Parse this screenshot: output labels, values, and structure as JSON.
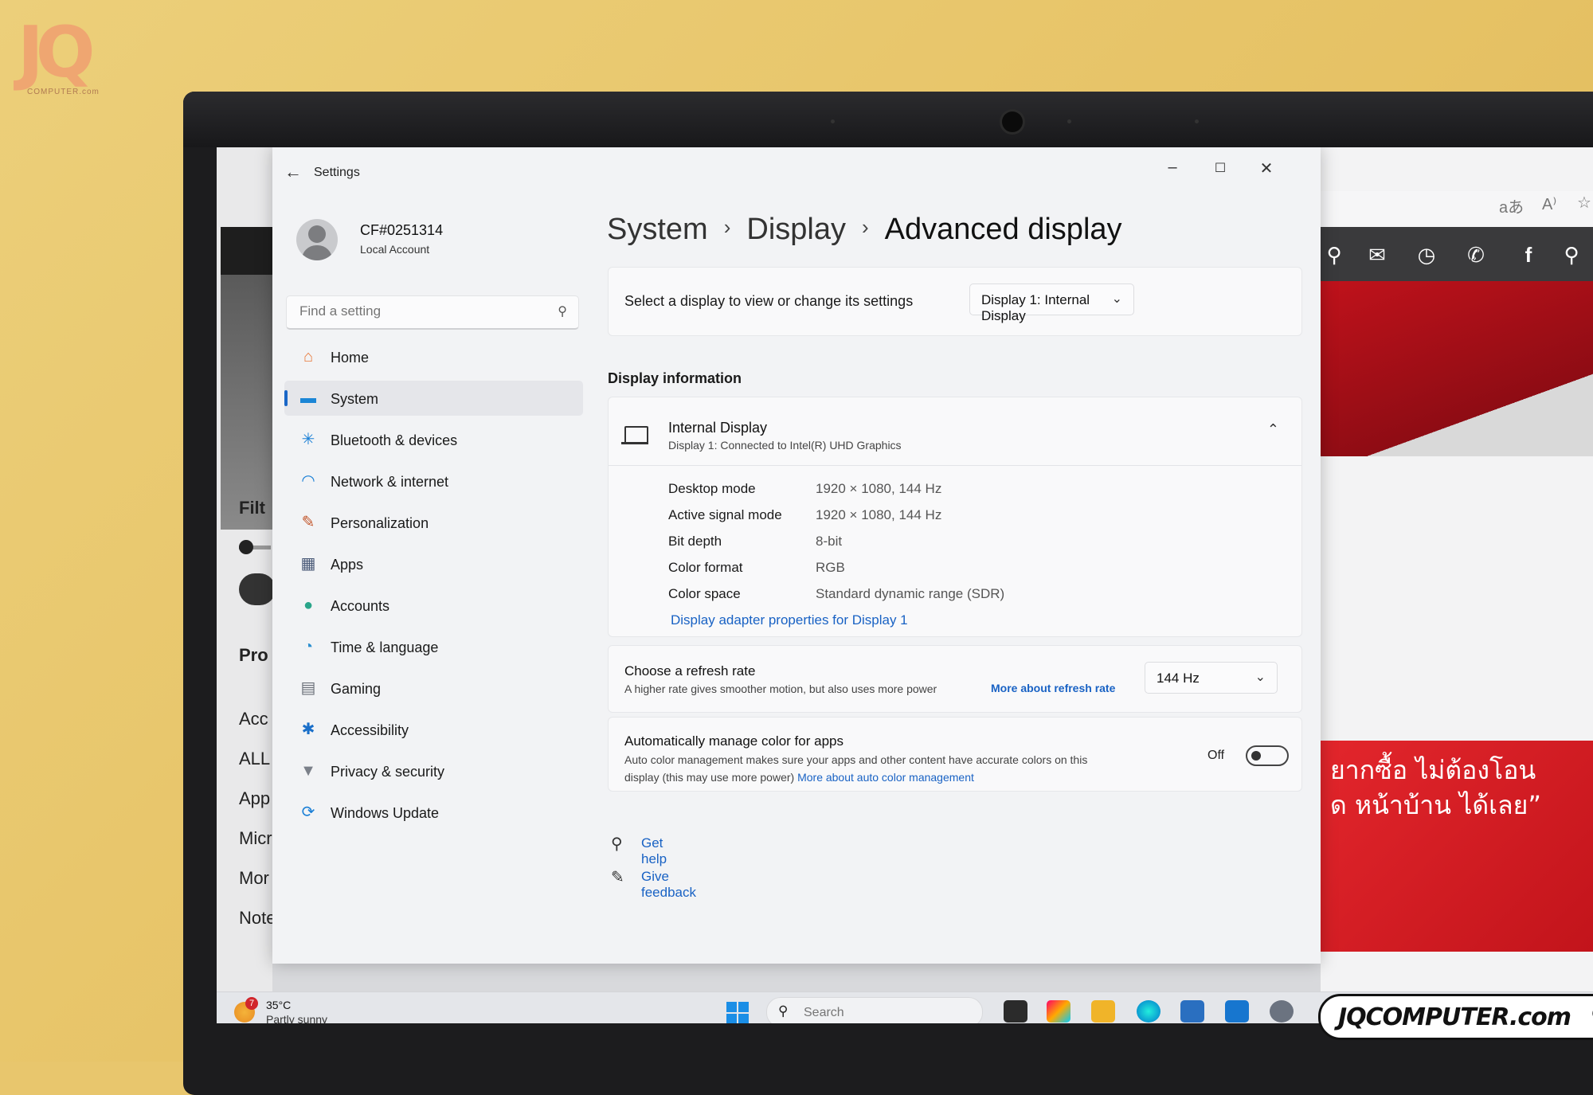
{
  "watermark_logo": "JQ",
  "watermark_logo_sub": "COMPUTER.com",
  "watermark_site": "JQCOMPUTER.com",
  "background_left": {
    "items": [
      "Filt",
      "Pro",
      "Acc",
      "ALL",
      "App",
      "Micr",
      "Mor",
      "Note"
    ]
  },
  "background_right": {
    "toolbar": [
      "aあ",
      "A⁾",
      "☆"
    ],
    "promo_lines": [
      "ยากซื้อ ไม่ต้องโอน",
      "ด หน้าบ้าน ได้เลย”"
    ]
  },
  "window": {
    "title": "Settings",
    "controls": {
      "minimize": "–",
      "maximize": "☐",
      "close": "✕"
    }
  },
  "profile": {
    "name": "CF#0251314",
    "account_type": "Local Account"
  },
  "search": {
    "placeholder": "Find a setting"
  },
  "nav": [
    {
      "label": "Home",
      "icon": "home-icon",
      "glyph": "⌂",
      "color": "#e8793a"
    },
    {
      "label": "System",
      "icon": "system-icon",
      "glyph": "▬",
      "color": "#1b86d6",
      "selected": true
    },
    {
      "label": "Bluetooth & devices",
      "icon": "bluetooth-icon",
      "glyph": "✳",
      "color": "#1a7fd6"
    },
    {
      "label": "Network & internet",
      "icon": "wifi-icon",
      "glyph": "◠",
      "color": "#1a7fd6"
    },
    {
      "label": "Personalization",
      "icon": "brush-icon",
      "glyph": "✎",
      "color": "#c2552a"
    },
    {
      "label": "Apps",
      "icon": "apps-icon",
      "glyph": "▦",
      "color": "#4a5a78"
    },
    {
      "label": "Accounts",
      "icon": "accounts-icon",
      "glyph": "●",
      "color": "#2aa58a"
    },
    {
      "label": "Time & language",
      "icon": "globe-clock-icon",
      "glyph": "◔",
      "color": "#2b8fd0"
    },
    {
      "label": "Gaming",
      "icon": "gamepad-icon",
      "glyph": "▤",
      "color": "#6a6f78"
    },
    {
      "label": "Accessibility",
      "icon": "accessibility-icon",
      "glyph": "✱",
      "color": "#1a6fc9"
    },
    {
      "label": "Privacy & security",
      "icon": "shield-icon",
      "glyph": "▼",
      "color": "#7b8089"
    },
    {
      "label": "Windows Update",
      "icon": "update-icon",
      "glyph": "⟳",
      "color": "#1a7fd6"
    }
  ],
  "breadcrumb": {
    "level1": "System",
    "level2": "Display",
    "current": "Advanced display"
  },
  "select_display": {
    "label": "Select a display to view or change its settings",
    "selected": "Display 1: Internal Display"
  },
  "display_info": {
    "heading": "Display information",
    "title": "Internal Display",
    "subtitle": "Display 1: Connected to Intel(R) UHD Graphics",
    "properties": [
      {
        "key": "Desktop mode",
        "value": "1920 × 1080, 144 Hz"
      },
      {
        "key": "Active signal mode",
        "value": "1920 × 1080, 144 Hz"
      },
      {
        "key": "Bit depth",
        "value": "8-bit"
      },
      {
        "key": "Color format",
        "value": "RGB"
      },
      {
        "key": "Color space",
        "value": "Standard dynamic range (SDR)"
      }
    ],
    "adapter_link": "Display adapter properties for Display 1"
  },
  "refresh_rate": {
    "title": "Choose a refresh rate",
    "description": "A higher rate gives smoother motion, but also uses more power",
    "more_link": "More about refresh rate",
    "selected": "144 Hz"
  },
  "auto_color": {
    "title": "Automatically manage color for apps",
    "description_line1": "Auto color management makes sure your apps and other content have accurate colors on this",
    "description_line2": "display (this may use more power)",
    "more_link": "More about auto color management",
    "toggle_label": "Off",
    "enabled": false
  },
  "help": {
    "get_help": "Get help",
    "give_feedback": "Give feedback"
  },
  "taskbar": {
    "weather_temp": "35°C",
    "weather_condition": "Partly sunny",
    "weather_badge": "7",
    "search_placeholder": "Search"
  },
  "colors": {
    "accent": "#1a67c7",
    "link": "#1962c4"
  }
}
